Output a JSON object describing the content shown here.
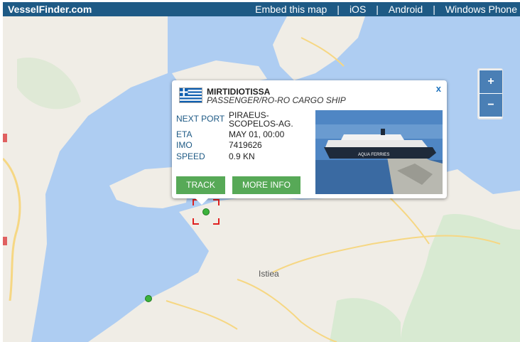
{
  "header": {
    "brand": "VesselFinder.com",
    "links": [
      "Embed this map",
      "iOS",
      "Android",
      "Windows Phone"
    ],
    "separator": "|",
    "background": "#1e5a85"
  },
  "map": {
    "town_label": "Istiea",
    "zoom_in": "+",
    "zoom_out": "−",
    "colors": {
      "sea": "#aecdf2",
      "land": "#f0ede6",
      "road": "#f6d783",
      "marker": "#3cb23c",
      "selection": "#e02020"
    }
  },
  "popup": {
    "close": "x",
    "vessel_name": "MIRTIDIOTISSA",
    "vessel_type": "PASSENGER/RO-RO CARGO SHIP",
    "flag": "greece-flag-icon",
    "fields": {
      "next_port_label": "NEXT PORT",
      "next_port_value_1": "PIRAEUS-",
      "next_port_value_2": "SCOPELOS-AG.",
      "eta_label": "ETA",
      "eta_value": "MAY 01, 00:00",
      "imo_label": "IMO",
      "imo_value": "7419626",
      "speed_label": "SPEED",
      "speed_value": "0.9 KN"
    },
    "photo_text": "AQUA FERRIES",
    "track_button": "TRACK",
    "more_info_button": "MORE INFO",
    "button_color": "#57a957"
  }
}
